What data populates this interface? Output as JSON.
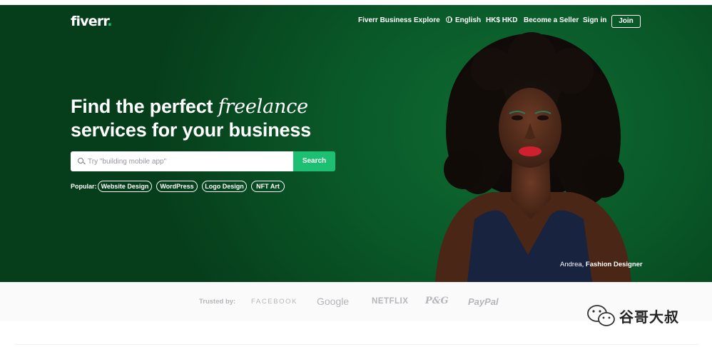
{
  "colors": {
    "hero_green": "#0a5a29",
    "accent_green": "#1dbf73",
    "trusted_gray": "#b5b6ba"
  },
  "header": {
    "logo": "fiverr",
    "logo_dot": ".",
    "nav": {
      "business": "Fiverr Business",
      "explore": "Explore",
      "language_icon": "globe-icon",
      "language": "English",
      "currency": "HK$ HKD",
      "seller": "Become a Seller",
      "signin": "Sign in",
      "join": "Join"
    }
  },
  "hero": {
    "headline_part1": "Find the perfect ",
    "headline_em": "freelance",
    "headline_line2": "services for your business",
    "search": {
      "icon": "search-icon",
      "placeholder": "Try \"building mobile app\"",
      "button": "Search"
    },
    "popular": {
      "label": "Popular:",
      "items": [
        "Website Design",
        "WordPress",
        "Logo Design",
        "NFT Art"
      ]
    },
    "caption": {
      "name": "Andrea, ",
      "role": "Fashion Designer"
    }
  },
  "trusted": {
    "label": "Trusted by:",
    "brands": [
      "FACEBOOK",
      "Google",
      "NETFLIX",
      "P&G",
      "PayPal"
    ]
  },
  "watermark": {
    "icon": "wechat-icon",
    "text": "谷哥大叔"
  }
}
